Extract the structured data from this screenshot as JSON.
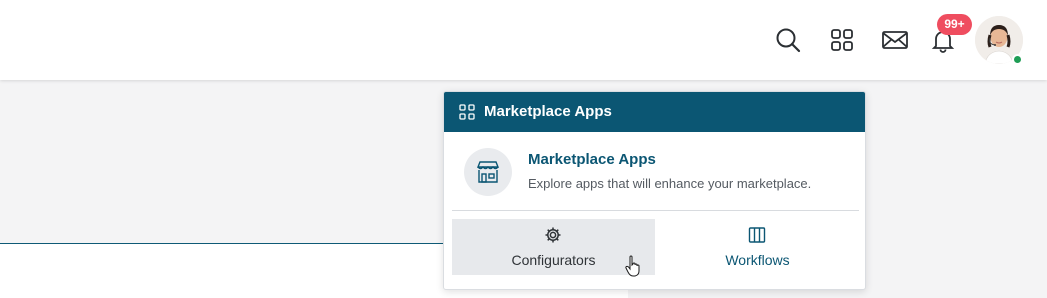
{
  "header": {
    "icons": [
      "search-icon",
      "apps-grid-icon",
      "mail-icon",
      "bell-icon"
    ],
    "notification_badge": "99+",
    "user_status": "online",
    "colors": {
      "badge": "#ef4d5f",
      "status": "#1f9d55"
    }
  },
  "dropdown": {
    "header_title": "Marketplace Apps",
    "item": {
      "title": "Marketplace Apps",
      "description": "Explore apps that will enhance your marketplace."
    },
    "options": [
      {
        "label": "Configurators",
        "icon": "gear-icon"
      },
      {
        "label": "Workflows",
        "icon": "columns-icon"
      }
    ],
    "colors": {
      "header_bg": "#0b5673",
      "accent": "#0b5673"
    }
  }
}
